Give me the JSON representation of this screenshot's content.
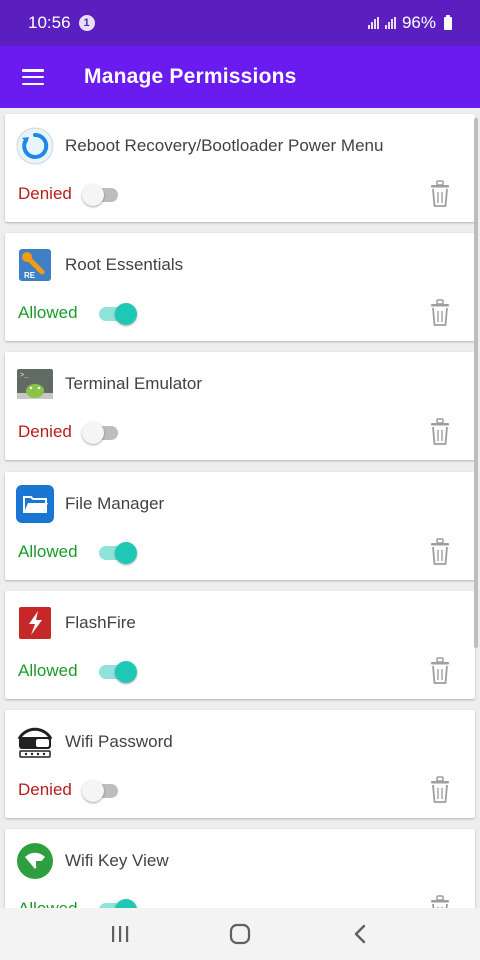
{
  "status_bar": {
    "time": "10:56",
    "notification_badge": "1",
    "battery": "96%"
  },
  "app_bar": {
    "title": "Manage Permissions",
    "menu_icon": "hamburger-menu-icon"
  },
  "permissions": [
    {
      "name": "Reboot Recovery/Bootloader Power Menu",
      "status": "Denied",
      "enabled": false,
      "icon": "reboot-icon"
    },
    {
      "name": "Root Essentials",
      "status": "Allowed",
      "enabled": true,
      "icon": "root-essentials-icon"
    },
    {
      "name": "Terminal Emulator",
      "status": "Denied",
      "enabled": false,
      "icon": "terminal-icon"
    },
    {
      "name": "File Manager",
      "status": "Allowed",
      "enabled": true,
      "icon": "folder-icon"
    },
    {
      "name": "FlashFire",
      "status": "Allowed",
      "enabled": true,
      "icon": "flashfire-icon"
    },
    {
      "name": "Wifi Password",
      "status": "Denied",
      "enabled": false,
      "icon": "wifi-password-icon"
    },
    {
      "name": "Wifi Key View",
      "status": "Allowed",
      "enabled": true,
      "icon": "wifi-key-icon"
    }
  ],
  "colors": {
    "status_bar": "#5b1fc0",
    "app_bar": "#6a1bf0",
    "denied": "#b71c1c",
    "allowed": "#1b9a2c",
    "toggle_on": "#1fc8b5"
  },
  "nav_bar": {
    "recents_icon": "recents-icon",
    "home_icon": "home-icon",
    "back_icon": "back-icon"
  }
}
